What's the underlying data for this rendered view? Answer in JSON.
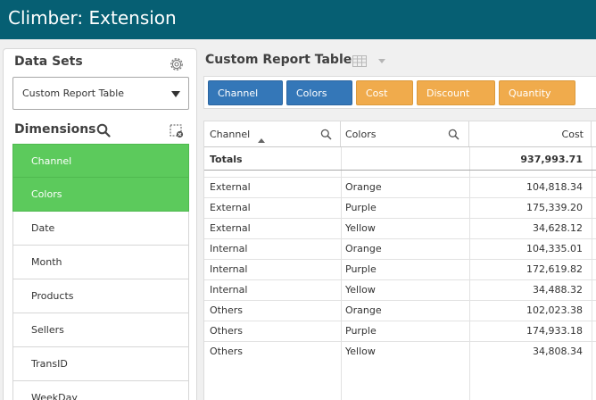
{
  "app": {
    "title": "Climber: Extension"
  },
  "datasets": {
    "title": "Data Sets",
    "selected": "Custom Report Table",
    "settings_icon": "gear-icon"
  },
  "dimensions": {
    "title": "Dimensions",
    "search_icon": "search-icon",
    "clear_icon": "clear-selection-icon",
    "items": [
      {
        "label": "Channel",
        "selected": true
      },
      {
        "label": "Colors",
        "selected": true
      },
      {
        "label": "Date",
        "selected": false
      },
      {
        "label": "Month",
        "selected": false
      },
      {
        "label": "Products",
        "selected": false
      },
      {
        "label": "Sellers",
        "selected": false
      },
      {
        "label": "TransID",
        "selected": false
      },
      {
        "label": "WeekDay",
        "selected": false
      }
    ]
  },
  "report": {
    "title": "Custom Report Table",
    "chips": [
      {
        "label": "Channel",
        "kind": "dimension"
      },
      {
        "label": "Colors",
        "kind": "dimension"
      },
      {
        "label": "Cost",
        "kind": "measure"
      },
      {
        "label": "Discount",
        "kind": "measure"
      },
      {
        "label": "Quantity",
        "kind": "measure"
      }
    ]
  },
  "table": {
    "headers": [
      "Channel",
      "Colors",
      "Cost"
    ],
    "totals": {
      "label": "Totals",
      "cost": "937,993.71"
    },
    "rows": [
      [
        "External",
        "Orange",
        "104,818.34"
      ],
      [
        "External",
        "Purple",
        "175,339.20"
      ],
      [
        "External",
        "Yellow",
        "34,628.12"
      ],
      [
        "Internal",
        "Orange",
        "104,335.01"
      ],
      [
        "Internal",
        "Purple",
        "172,619.82"
      ],
      [
        "Internal",
        "Yellow",
        "34,488.32"
      ],
      [
        "Others",
        "Orange",
        "102,023.38"
      ],
      [
        "Others",
        "Purple",
        "174,933.18"
      ],
      [
        "Others",
        "Yellow",
        "34,808.34"
      ]
    ]
  },
  "colors": {
    "header_bg": "#065f73",
    "selected_green": "#5cca5c",
    "chip_blue": "#3477b8",
    "chip_orange": "#f0ab4c"
  }
}
